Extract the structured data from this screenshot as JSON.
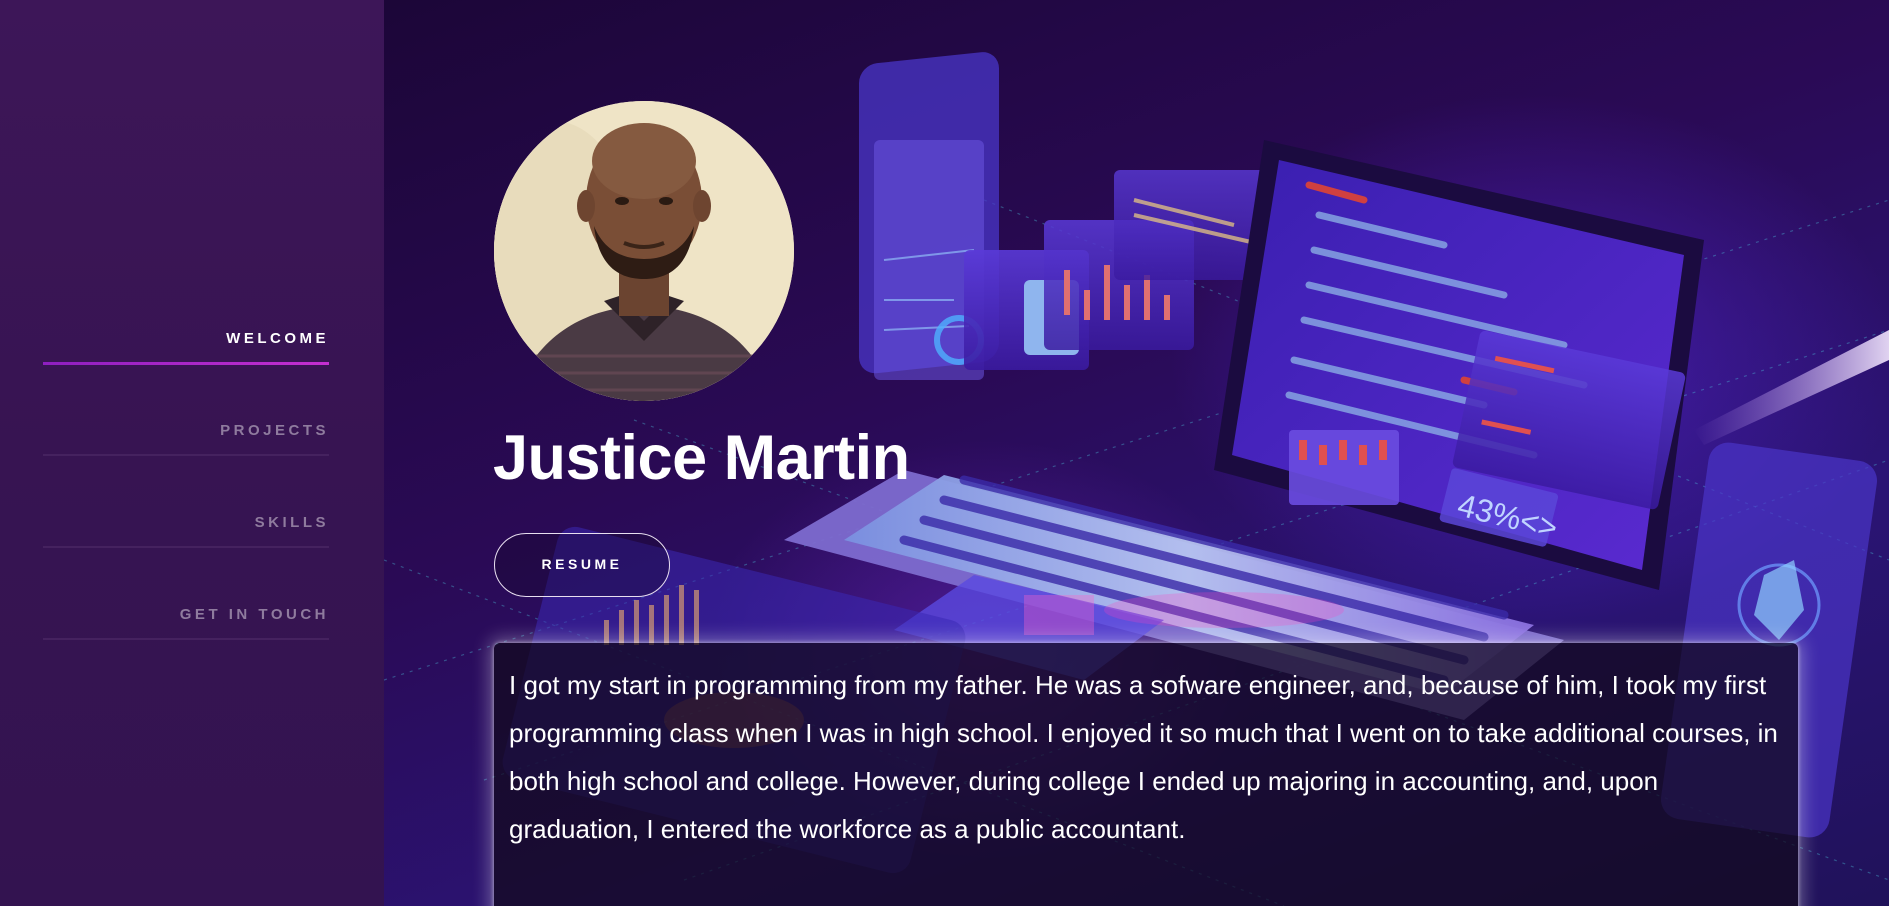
{
  "nav": {
    "items": [
      {
        "label": "WELCOME",
        "active": true
      },
      {
        "label": "PROJECTS",
        "active": false
      },
      {
        "label": "SKILLS",
        "active": false
      },
      {
        "label": "GET IN TOUCH",
        "active": false
      }
    ]
  },
  "hero": {
    "name": "Justice Martin",
    "resume_label": "RESUME",
    "bio": "I got my start in programming from my father. He was a sofware engineer, and, because of him, I took my first programming class when I was in high school. I enjoyed it so much that I went on to take additional courses, in both high school and college. However, during college I ended up majoring in accounting, and, upon graduation, I entered the workforce as a public accountant.",
    "illustration_text": "43%<>"
  },
  "colors": {
    "sidebar": "#3a1556",
    "accent": "#b12bd0",
    "nav_inactive": "#8f7b9e",
    "text": "#ffffff"
  }
}
